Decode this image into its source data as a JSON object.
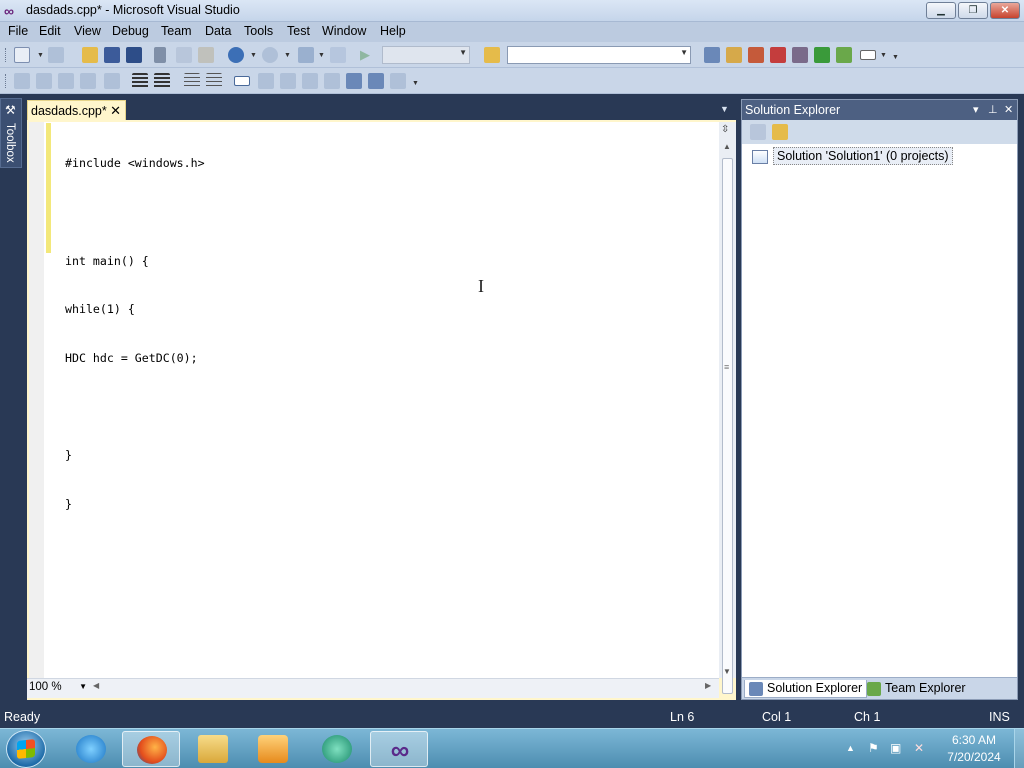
{
  "window": {
    "title": "dasdads.cpp* - Microsoft Visual Studio",
    "minimize": "▁",
    "maximize": "❐",
    "close": "✕"
  },
  "menu": [
    "File",
    "Edit",
    "View",
    "Debug",
    "Team",
    "Data",
    "Tools",
    "Test",
    "Window",
    "Help"
  ],
  "toolbox": {
    "label": "Toolbox"
  },
  "editor": {
    "tab_label": "dasdads.cpp*",
    "tab_close": "✕",
    "code_lines": [
      "#include <windows.h>",
      "",
      "int main() {",
      "while(1) {",
      "HDC hdc = GetDC(0);",
      "",
      "}",
      "}"
    ],
    "zoom": "100 %"
  },
  "solution_explorer": {
    "title": "Solution Explorer",
    "item": "Solution 'Solution1' (0 projects)",
    "tabs": [
      "Solution Explorer",
      "Team Explorer"
    ]
  },
  "status": {
    "state": "Ready",
    "line": "Ln 6",
    "col": "Col 1",
    "ch": "Ch 1",
    "mode": "INS"
  },
  "taskbar": {
    "time": "6:30 AM",
    "date": "7/20/2024"
  },
  "colors": {
    "vs_purple": "#68217a",
    "chrome_dark": "#293955",
    "change_bar": "#f3e87a"
  }
}
